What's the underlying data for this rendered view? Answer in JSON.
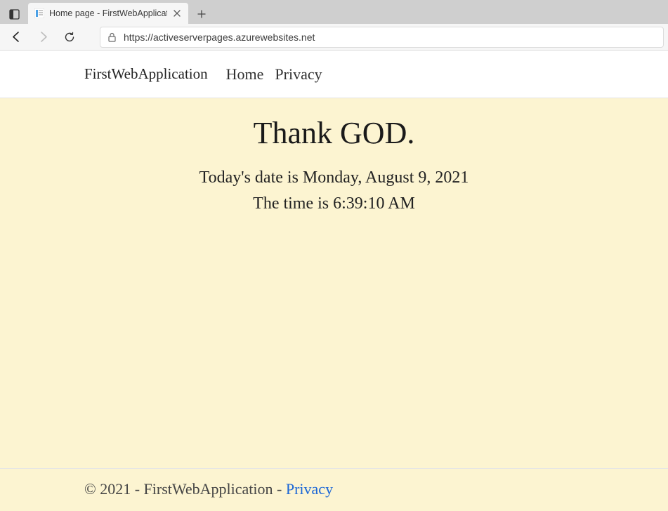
{
  "browser": {
    "tab_title": "Home page - FirstWebApplicatio",
    "url": "https://activeserverpages.azurewebsites.net"
  },
  "nav": {
    "brand": "FirstWebApplication",
    "links": [
      "Home",
      "Privacy"
    ]
  },
  "main": {
    "heading": "Thank GOD.",
    "date_line": "Today's date is Monday, August 9, 2021",
    "time_line": "The time is 6:39:10 AM"
  },
  "footer": {
    "text_prefix": "© 2021 - FirstWebApplication - ",
    "privacy_label": "Privacy"
  }
}
